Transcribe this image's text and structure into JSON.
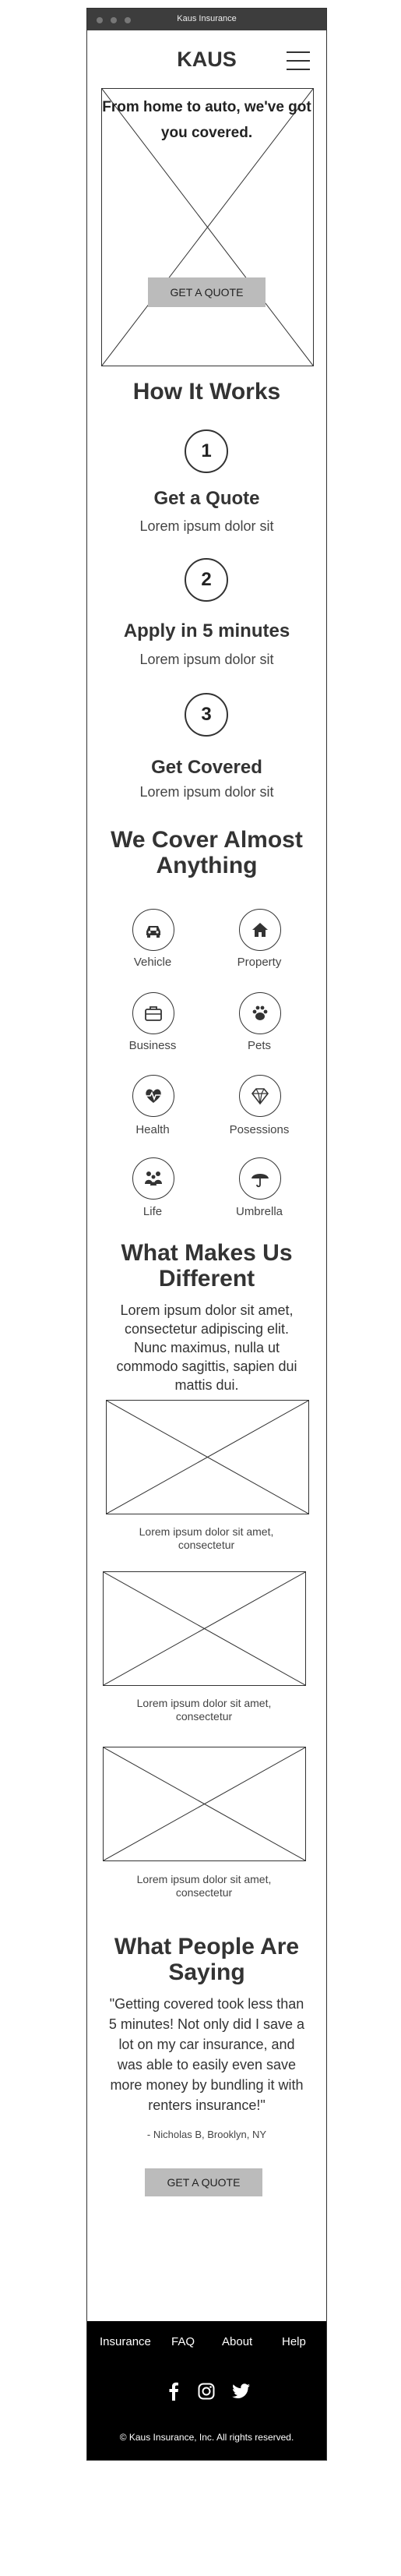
{
  "window": {
    "title": "Kaus Insurance"
  },
  "header": {
    "brand": "KAUS"
  },
  "hero": {
    "headline": "From home to auto, we've got you covered.",
    "cta": "GET A QUOTE"
  },
  "how": {
    "title": "How It Works",
    "steps": [
      {
        "number": "1",
        "title": "Get a Quote",
        "text": "Lorem ipsum dolor sit"
      },
      {
        "number": "2",
        "title": "Apply in 5 minutes",
        "text": "Lorem ipsum dolor sit"
      },
      {
        "number": "3",
        "title": "Get Covered",
        "text": "Lorem ipsum dolor sit"
      }
    ]
  },
  "cover": {
    "title": "We Cover Almost Anything",
    "items": [
      {
        "label": "Vehicle",
        "icon": "car-icon"
      },
      {
        "label": "Property",
        "icon": "home-icon"
      },
      {
        "label": "Business",
        "icon": "briefcase-icon"
      },
      {
        "label": "Pets",
        "icon": "paw-icon"
      },
      {
        "label": "Health",
        "icon": "heartbeat-icon"
      },
      {
        "label": "Posessions",
        "icon": "diamond-icon"
      },
      {
        "label": "Life",
        "icon": "family-icon"
      },
      {
        "label": "Umbrella",
        "icon": "umbrella-icon"
      }
    ]
  },
  "different": {
    "title": "What Makes Us Different",
    "text": "Lorem ipsum dolor sit amet, consectetur adipiscing elit. Nunc maximus, nulla ut commodo sagittis, sapien dui mattis dui.",
    "cards": [
      {
        "caption": "Lorem ipsum dolor sit amet, consectetur"
      },
      {
        "caption": "Lorem ipsum dolor sit amet, consectetur"
      },
      {
        "caption": "Lorem ipsum dolor sit amet, consectetur"
      }
    ]
  },
  "testimonial": {
    "title": "What People Are Saying",
    "quote": "\"Getting covered took less than 5 minutes! Not only did I save a lot on my car insurance, and was able to easily even save more money by bundling it with renters insurance!\"",
    "author": "- Nicholas B, Brooklyn, NY",
    "cta": "GET A QUOTE"
  },
  "footer": {
    "links": [
      "Insurance",
      "FAQ",
      "About",
      "Help"
    ],
    "social": [
      "facebook-icon",
      "instagram-icon",
      "twitter-icon"
    ],
    "copyright": "Kaus Insurance, Inc. All rights reserved."
  }
}
